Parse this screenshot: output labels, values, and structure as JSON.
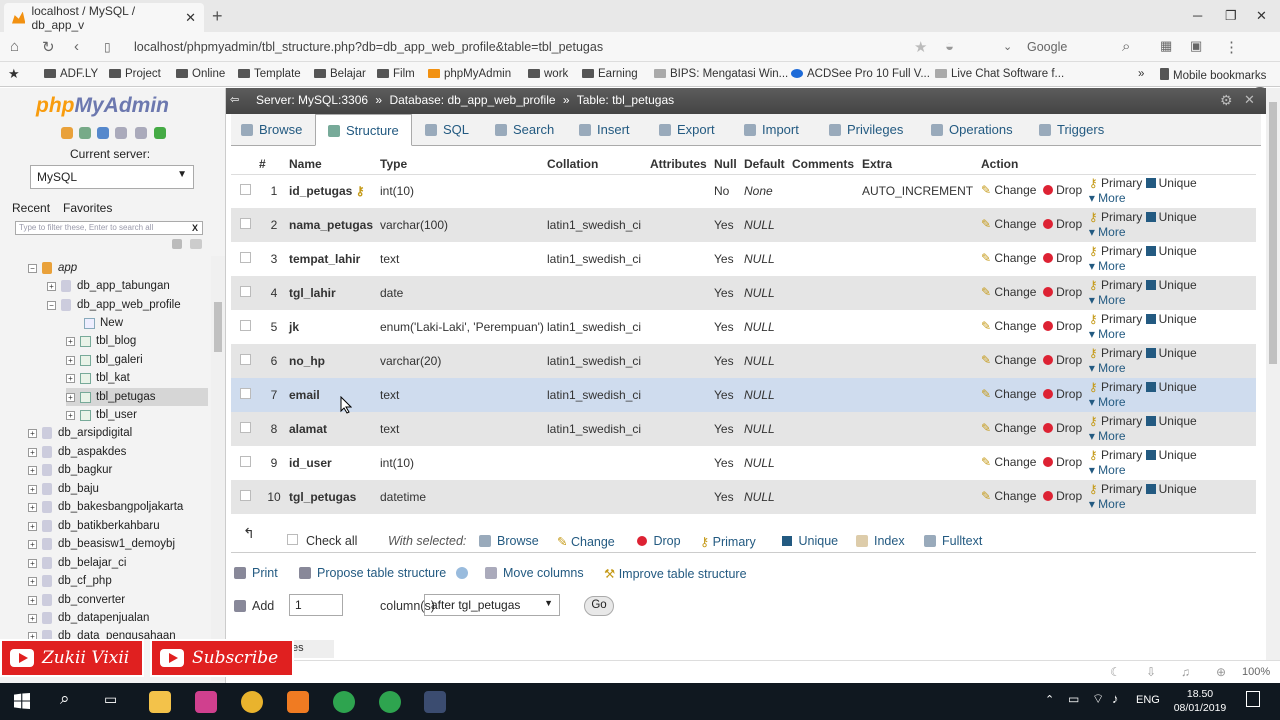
{
  "browser": {
    "tab_title": "localhost / MySQL / db_app_v",
    "url": "localhost/phpmyadmin/tbl_structure.php?db=db_app_web_profile&table=tbl_petugas",
    "search_engine": "Google",
    "bookmarks": [
      "ADF.LY",
      "Project",
      "Online",
      "Template",
      "Belajar",
      "Film",
      "phpMyAdmin",
      "work",
      "Earning",
      "BIPS: Mengatasi Win...",
      "ACDSee Pro 10 Full V...",
      "Live Chat Software f..."
    ],
    "mobile_bookmarks": "Mobile bookmarks"
  },
  "sidebar": {
    "logo_php": "php",
    "logo_myadmin": "MyAdmin",
    "current_server_label": "Current server:",
    "server_value": "MySQL",
    "tab_recent": "Recent",
    "tab_favorites": "Favorites",
    "filter_placeholder": "Type to filter these, Enter to search all",
    "tree": [
      "app",
      "db_app_tabungan",
      "db_app_web_profile",
      "New",
      "tbl_blog",
      "tbl_galeri",
      "tbl_kat",
      "tbl_petugas",
      "tbl_user",
      "db_arsipdigital",
      "db_aspakdes",
      "db_bagkur",
      "db_baju",
      "db_bakesbangpoljakarta",
      "db_batikberkahbaru",
      "db_beasisw1_demoybj",
      "db_belajar_ci",
      "db_cf_php",
      "db_converter",
      "db_datapenjualan",
      "db_data_pengusahaan"
    ]
  },
  "breadcrumb": {
    "server": "Server: MySQL:3306",
    "database": "Database: db_app_web_profile",
    "table": "Table: tbl_petugas"
  },
  "tabs": [
    "Browse",
    "Structure",
    "SQL",
    "Search",
    "Insert",
    "Export",
    "Import",
    "Privileges",
    "Operations",
    "Triggers"
  ],
  "columns_header": [
    "#",
    "Name",
    "Type",
    "Collation",
    "Attributes",
    "Null",
    "Default",
    "Comments",
    "Extra",
    "Action"
  ],
  "rows": [
    {
      "n": "1",
      "name": "id_petugas",
      "type": "int(10)",
      "collation": "",
      "null": "No",
      "default": "None",
      "extra": "AUTO_INCREMENT"
    },
    {
      "n": "2",
      "name": "nama_petugas",
      "type": "varchar(100)",
      "collation": "latin1_swedish_ci",
      "null": "Yes",
      "default": "NULL",
      "extra": ""
    },
    {
      "n": "3",
      "name": "tempat_lahir",
      "type": "text",
      "collation": "latin1_swedish_ci",
      "null": "Yes",
      "default": "NULL",
      "extra": ""
    },
    {
      "n": "4",
      "name": "tgl_lahir",
      "type": "date",
      "collation": "",
      "null": "Yes",
      "default": "NULL",
      "extra": ""
    },
    {
      "n": "5",
      "name": "jk",
      "type": "enum('Laki-Laki', 'Perempuan')",
      "collation": "latin1_swedish_ci",
      "null": "Yes",
      "default": "NULL",
      "extra": ""
    },
    {
      "n": "6",
      "name": "no_hp",
      "type": "varchar(20)",
      "collation": "latin1_swedish_ci",
      "null": "Yes",
      "default": "NULL",
      "extra": ""
    },
    {
      "n": "7",
      "name": "email",
      "type": "text",
      "collation": "latin1_swedish_ci",
      "null": "Yes",
      "default": "NULL",
      "extra": ""
    },
    {
      "n": "8",
      "name": "alamat",
      "type": "text",
      "collation": "latin1_swedish_ci",
      "null": "Yes",
      "default": "NULL",
      "extra": ""
    },
    {
      "n": "9",
      "name": "id_user",
      "type": "int(10)",
      "collation": "",
      "null": "Yes",
      "default": "NULL",
      "extra": ""
    },
    {
      "n": "10",
      "name": "tgl_petugas",
      "type": "datetime",
      "collation": "",
      "null": "Yes",
      "default": "NULL",
      "extra": ""
    }
  ],
  "actions": {
    "change": "Change",
    "drop": "Drop",
    "primary": "Primary",
    "unique": "Unique",
    "more": "More"
  },
  "with_selected": {
    "check_all": "Check all",
    "label": "With selected:",
    "items": [
      "Browse",
      "Change",
      "Drop",
      "Primary",
      "Unique",
      "Index",
      "Fulltext"
    ]
  },
  "tools": {
    "print": "Print",
    "propose": "Propose table structure",
    "move": "Move columns",
    "improve": "Improve table structure"
  },
  "add_columns": {
    "add": "Add",
    "count": "1",
    "columns_label": "column(s)",
    "position": "after tgl_petugas",
    "go": "Go"
  },
  "status": {
    "zoom": "100%"
  },
  "overlay": {
    "channel": "Zukii Vixii",
    "subscribe": "Subscribe",
    "partial": "es"
  },
  "taskbar": {
    "lang": "ENG",
    "time": "18.50",
    "date": "08/01/2019"
  },
  "colors": {
    "pma_blue": "#235a81",
    "breadcrumb_bg": "#4f4f4f",
    "row_even": "#e5e5e5",
    "row_hover": "#cfdcee",
    "taskbar": "#101820",
    "youtube_red": "#e02020"
  }
}
